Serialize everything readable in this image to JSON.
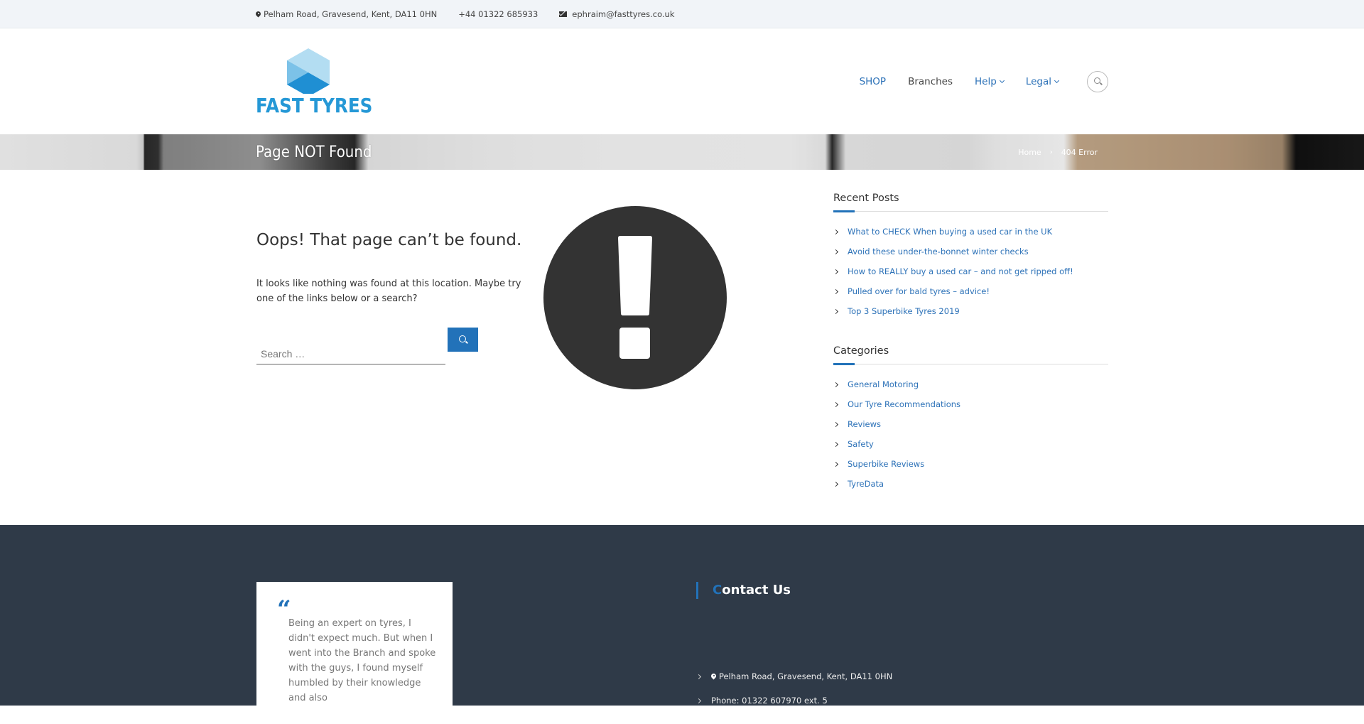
{
  "topbar": {
    "address": "Pelham Road, Gravesend, Kent, DA11 0HN",
    "phone": "+44 01322 685933",
    "email": "ephraim@fasttyres.co.uk"
  },
  "header": {
    "logo_text": "FAST TYRES",
    "nav": [
      {
        "label": "SHOP",
        "has_dropdown": false
      },
      {
        "label": "Branches",
        "has_dropdown": false
      },
      {
        "label": "Help",
        "has_dropdown": true
      },
      {
        "label": "Legal",
        "has_dropdown": true
      }
    ],
    "search_icon": "search-icon"
  },
  "banner": {
    "title": "Page NOT Found",
    "breadcrumb": [
      "Home",
      "404 Error"
    ],
    "separator": "›"
  },
  "main": {
    "heading": "Oops! That page can’t be found.",
    "description": "It looks like nothing was found at this location. Maybe try one of the links below or a search?",
    "search": {
      "placeholder": "Search …",
      "value": "",
      "button_icon": "search-icon"
    },
    "illustration_icon": "exclamation-circle-icon"
  },
  "sidebar": {
    "recent_posts": {
      "title": "Recent Posts",
      "items": [
        "What to CHECK When buying a used car in the UK",
        "Avoid these under-the-bonnet winter checks",
        "How to REALLY buy a used car – and not get ripped off!",
        "Pulled over for bald tyres – advice!",
        "Top 3 Superbike Tyres 2019"
      ]
    },
    "categories": {
      "title": "Categories",
      "items": [
        "General Motoring",
        "Our Tyre Recommendations",
        "Reviews",
        "Safety",
        "Superbike Reviews",
        "TyreData"
      ]
    }
  },
  "footer": {
    "testimonial": {
      "quote_icon": "“",
      "text": "Being an expert on tyres, I didn't expect much. But when I went into the Branch and spoke with the guys, I found myself humbled by their knowledge and also"
    },
    "contact": {
      "title_first": "C",
      "title_rest": "ontact Us",
      "items": [
        {
          "icon": "map-pin-icon",
          "text": "Pelham Road, Gravesend, Kent, DA11 0HN"
        },
        {
          "icon": "",
          "text": "Phone: 01322 607970 ext. 5"
        }
      ]
    }
  },
  "colors": {
    "accent": "#2272b9",
    "link": "#2d72b8",
    "logo": "#2598d6",
    "footer_bg": "#2f3a48",
    "topbar_bg": "#f1f4f8",
    "icon_dark": "#333333"
  }
}
